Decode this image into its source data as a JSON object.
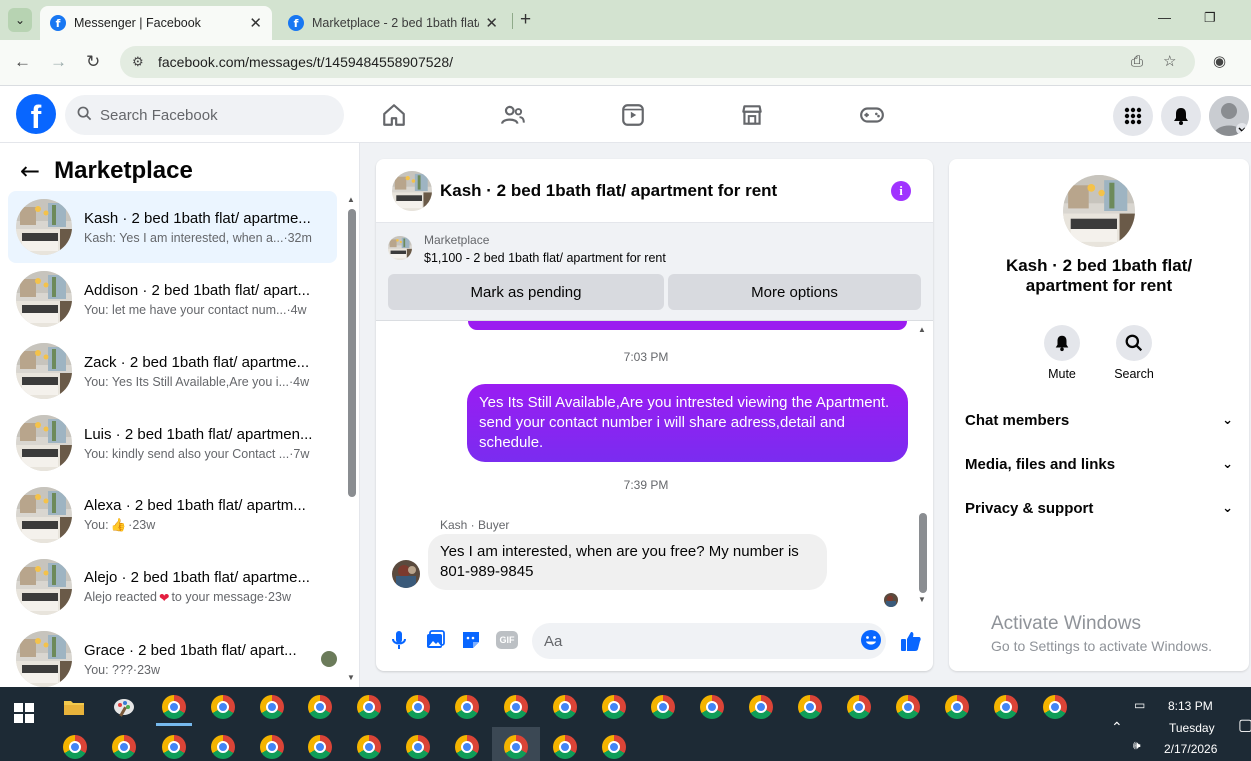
{
  "browser": {
    "tabs": [
      {
        "title": "Messenger | Facebook",
        "active": true
      },
      {
        "title": "Marketplace - 2 bed 1bath flat/",
        "active": false
      }
    ],
    "url": "facebook.com/messages/t/1459484558907528/"
  },
  "fb_nav": {
    "search_placeholder": "Search Facebook",
    "logo": "f"
  },
  "left_panel": {
    "title": "Marketplace",
    "chats": [
      {
        "name": "Kash · 2 bed 1bath flat/ apartme...",
        "preview": "Kash: Yes I am interested, when a...",
        "time": "·32m",
        "selected": true
      },
      {
        "name": "Addison · 2 bed 1bath flat/ apart...",
        "preview": "You: let me have your contact num...",
        "time": "·4w"
      },
      {
        "name": "Zack · 2 bed 1bath flat/ apartme...",
        "preview": "You: Yes Its Still Available,Are you i...",
        "time": "·4w"
      },
      {
        "name": "Luis · 2 bed 1bath flat/ apartmen...",
        "preview": "You: kindly send also your Contact ...",
        "time": "·7w"
      },
      {
        "name": "Alexa · 2 bed 1bath flat/ apartm...",
        "preview": "You: ",
        "time": "·23w",
        "emoji": "👍"
      },
      {
        "name": "Alejo · 2 bed 1bath flat/ apartme...",
        "preview": "Alejo reacted ",
        "preview2": " to your message",
        "time": "·23w",
        "emoji": "❤"
      },
      {
        "name": "Grace · 2 bed 1bath flat/ apart...",
        "preview": "You: ???",
        "time": "·23w"
      }
    ]
  },
  "chat": {
    "title": "Kash · 2 bed 1bath flat/ apartment for rent",
    "info_icon": "i",
    "marketplace_label": "Marketplace",
    "listing": "$1,100 - 2 bed 1bath flat/ apartment for rent",
    "mark_pending": "Mark as pending",
    "more_options": "More options",
    "time1": "7:03 PM",
    "outgoing_message": "Yes Its Still Available,Are you intrested viewing the Apartment. send your contact number i will share adress,detail and schedule.",
    "time2": "7:39 PM",
    "incoming_sender": "Kash · Buyer",
    "incoming_message": "Yes I am interested, when are you free? My number is 801-989-9845",
    "composer_placeholder": "Aa",
    "gif_label": "GIF"
  },
  "right_panel": {
    "title": "Kash · 2 bed 1bath flat/ apartment for rent",
    "mute": "Mute",
    "search": "Search",
    "sections": [
      "Chat members",
      "Media, files and links",
      "Privacy & support"
    ]
  },
  "watermark": {
    "line1": "Activate Windows",
    "line2": "Go to Settings to activate Windows."
  },
  "taskbar": {
    "time": "8:13 PM",
    "day": "Tuesday",
    "date": "2/17/2026"
  },
  "colors": {
    "fb_blue": "#0866ff",
    "messenger_purple": "#8a24f1",
    "selected_chat_bg": "#ebf5ff",
    "taskbar_bg": "#1d2a35"
  }
}
